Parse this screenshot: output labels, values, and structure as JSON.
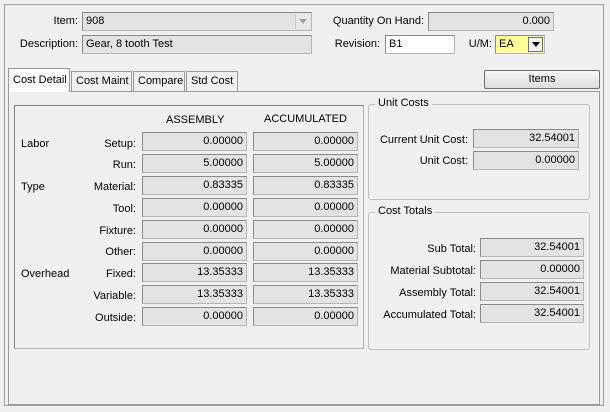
{
  "header": {
    "item_label": "Item:",
    "item_value": "908",
    "description_label": "Description:",
    "description_value": "Gear, 8 tooth Test",
    "qoh_label": "Quantity On Hand:",
    "qoh_value": "0.000",
    "revision_label": "Revision:",
    "revision_value": "B1",
    "um_label": "U/M:",
    "um_value": "EA"
  },
  "tabs": [
    {
      "label": "Cost Detail",
      "active": true
    },
    {
      "label": "Cost Maint",
      "active": false
    },
    {
      "label": "Compare",
      "active": false
    },
    {
      "label": "Std Cost",
      "active": false
    }
  ],
  "items_button": "Items",
  "cost_detail": {
    "col_assembly": "ASSEMBLY",
    "col_accumulated": "ACCUMULATED",
    "group_labels": {
      "labor": "Labor",
      "type": "Type",
      "overhead": "Overhead"
    },
    "rows": [
      {
        "label": "Setup:",
        "assembly": "0.00000",
        "accumulated": "0.00000"
      },
      {
        "label": "Run:",
        "assembly": "5.00000",
        "accumulated": "5.00000"
      },
      {
        "label": "Material:",
        "assembly": "0.83335",
        "accumulated": "0.83335"
      },
      {
        "label": "Tool:",
        "assembly": "0.00000",
        "accumulated": "0.00000"
      },
      {
        "label": "Fixture:",
        "assembly": "0.00000",
        "accumulated": "0.00000"
      },
      {
        "label": "Other:",
        "assembly": "0.00000",
        "accumulated": "0.00000"
      },
      {
        "label": "Fixed:",
        "assembly": "13.35333",
        "accumulated": "13.35333"
      },
      {
        "label": "Variable:",
        "assembly": "13.35333",
        "accumulated": "13.35333"
      },
      {
        "label": "Outside:",
        "assembly": "0.00000",
        "accumulated": "0.00000"
      }
    ]
  },
  "unit_costs": {
    "title": "Unit Costs",
    "current_label": "Current Unit Cost:",
    "current_value": "32.54001",
    "unit_label": "Unit Cost:",
    "unit_value": "0.00000"
  },
  "cost_totals": {
    "title": "Cost Totals",
    "sub_total_label": "Sub Total:",
    "sub_total_value": "32.54001",
    "material_label": "Material Subtotal:",
    "material_value": "0.00000",
    "assembly_label": "Assembly Total:",
    "assembly_value": "32.54001",
    "accumulated_label": "Accumulated Total:",
    "accumulated_value": "32.54001"
  },
  "colors": {
    "highlight_field": "#ffff99",
    "readonly_field": "#e3e3e3"
  },
  "icons": {
    "dropdown": "chevron-down-icon"
  }
}
